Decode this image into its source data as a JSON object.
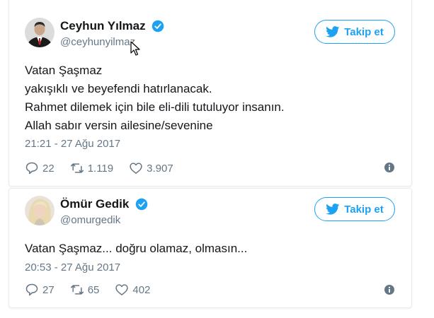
{
  "colors": {
    "brand_blue": "#1da1f2",
    "text_dark": "#14171a",
    "text_gray": "#657786",
    "verified_blue": "#1da1f2",
    "border": "#e6ecf0"
  },
  "tweets": [
    {
      "author": {
        "name": "Ceyhun Yılmaz",
        "handle": "@ceyhunyilmaz",
        "verified": true,
        "avatar_icon": "man-in-suit-avatar"
      },
      "follow_label": "Takip et",
      "text": "Vatan Şaşmaz\nyakışıklı ve beyefendi hatırlanacak.\nRahmet dilemek için bile eli-dili tutuluyor insanın.\nAllah sabır versin ailesine/sevenine",
      "timestamp": "21:21 - 27 Ağu 2017",
      "replies": "22",
      "retweets": "1.119",
      "likes": "3.907"
    },
    {
      "author": {
        "name": "Ömür Gedik",
        "handle": "@omurgedik",
        "verified": true,
        "avatar_icon": "blonde-woman-avatar"
      },
      "follow_label": "Takip et",
      "text": "Vatan Şaşmaz... doğru olamaz, olmasın...",
      "timestamp": "20:53 - 27 Ağu 2017",
      "replies": "27",
      "retweets": "65",
      "likes": "402"
    }
  ]
}
